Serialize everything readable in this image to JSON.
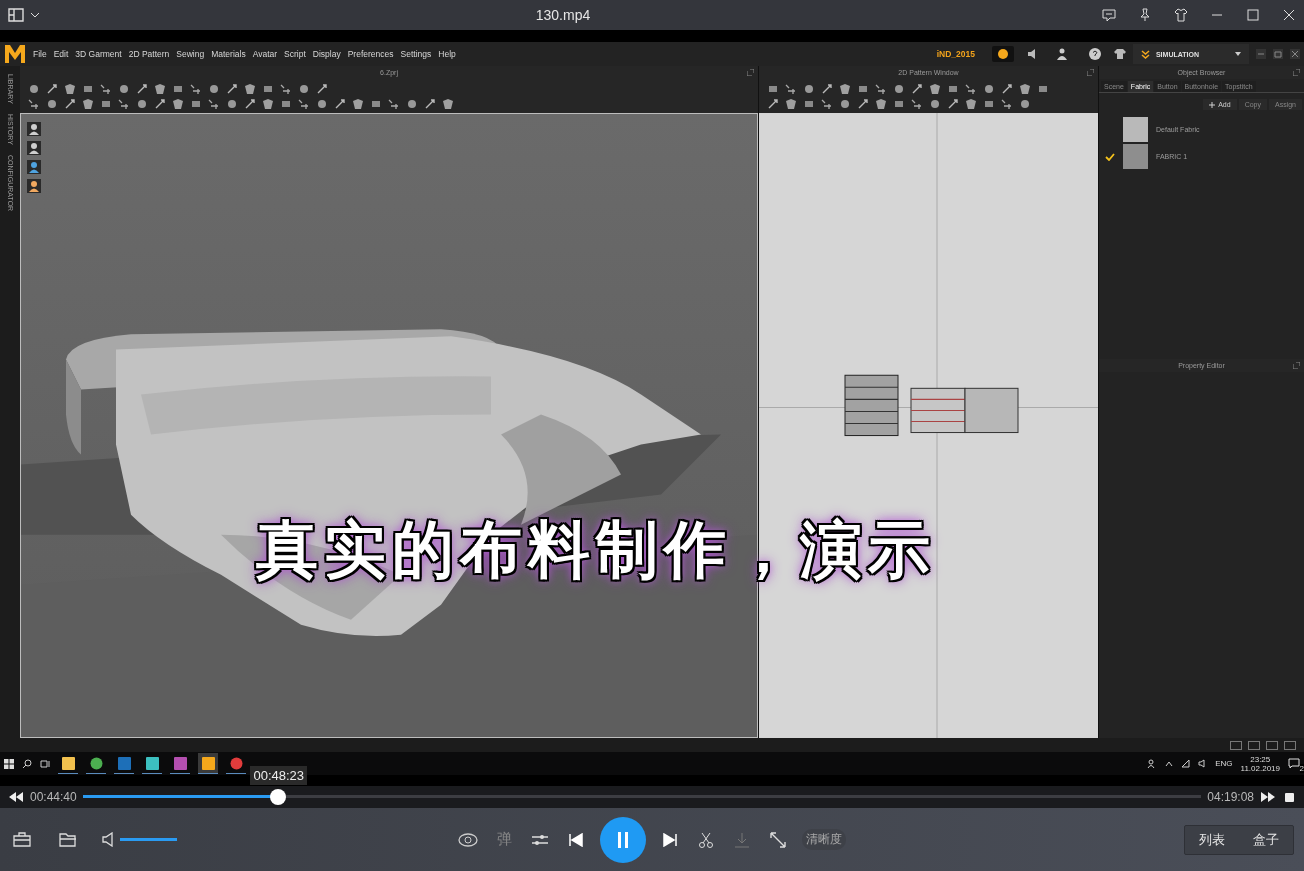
{
  "player": {
    "title": "130.mp4"
  },
  "app": {
    "menu": [
      "File",
      "Edit",
      "3D Garment",
      "2D Pattern",
      "Sewing",
      "Materials",
      "Avatar",
      "Script",
      "Display",
      "Preferences",
      "Settings",
      "Help"
    ],
    "user": "iND_2015",
    "mode": "SIMULATION",
    "side_labels": [
      "LIBRARY",
      "HISTORY",
      "CONFIGURATOR"
    ],
    "viewport_title": "6.Zprj",
    "pattern_title": "2D Pattern Window",
    "object_browser": {
      "title": "Object Browser",
      "tabs": [
        {
          "label": "Scene",
          "selected": false
        },
        {
          "label": "Fabric",
          "selected": true
        },
        {
          "label": "Button",
          "selected": false
        },
        {
          "label": "Buttonhole",
          "selected": false
        },
        {
          "label": "Topstitch",
          "selected": false
        }
      ],
      "actions": [
        {
          "label": "Add",
          "disabled": false
        },
        {
          "label": "Copy",
          "disabled": true
        },
        {
          "label": "Assign",
          "disabled": true
        }
      ],
      "fabrics": [
        {
          "name": "Default Fabric",
          "checked": false,
          "color": "#b9b9b9"
        },
        {
          "name": "FABRIC 1",
          "checked": true,
          "color": "#8e8e8e"
        }
      ]
    },
    "property_editor": {
      "title": "Property Editor"
    }
  },
  "caption": "真实的布料制作，演示",
  "taskbar": {
    "language": "ENG",
    "time": "23:25",
    "date": "11.02.2019",
    "notifications": "2"
  },
  "seek": {
    "elapsed": "00:44:40",
    "total": "04:19:08",
    "hover_time": "00:48:23",
    "level": 0.175
  },
  "controls": {
    "danmaku": "弹",
    "quality": "清晰度",
    "volume": {
      "level": 1
    },
    "panels": [
      "列表",
      "盒子"
    ]
  }
}
